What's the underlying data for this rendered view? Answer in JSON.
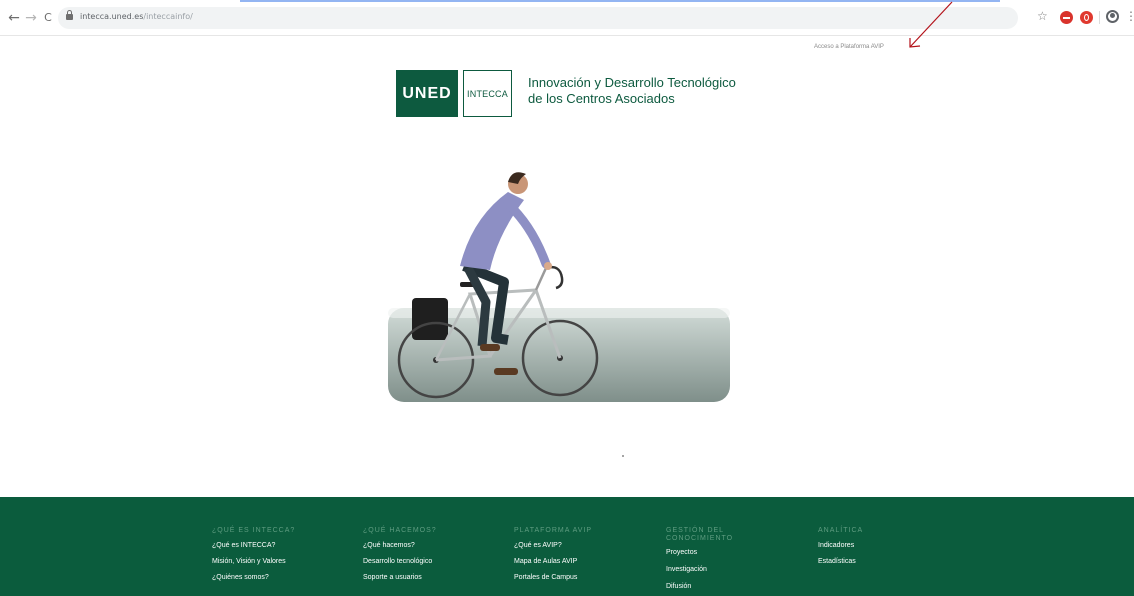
{
  "browser": {
    "url_host": "intecca.uned.es",
    "url_path": "/inteccainfo/",
    "icons": [
      "back-arrow-icon",
      "forward-arrow-icon",
      "reload-icon",
      "lock-icon",
      "star-icon",
      "extension-icon",
      "opera-icon",
      "profile-icon",
      "kebab-menu-icon"
    ],
    "glyphs": {
      "back": "←",
      "forward": "→",
      "reload": "C",
      "star": "☆",
      "menu": "⋮"
    }
  },
  "header": {
    "access_link": "Acceso a Plataforma AVIP",
    "annotation_arrow_color": "#b3121a"
  },
  "brand": {
    "uned": "UNED",
    "intecca": "INTECCA",
    "tagline_line1": "Innovación y Desarrollo Tecnológico",
    "tagline_line2": "de los Centros Asociados",
    "color": "#0d5a3f"
  },
  "footer": {
    "background": "#0b5c3d",
    "columns": [
      {
        "heading": "¿QUÉ ES INTECCA?",
        "links": [
          "¿Qué es INTECCA?",
          "Misión, Visión y Valores",
          "¿Quiénes somos?"
        ]
      },
      {
        "heading": "¿QUÉ HACEMOS?",
        "links": [
          "¿Qué hacemos?",
          "Desarrollo tecnológico",
          "Soporte a usuarios"
        ]
      },
      {
        "heading": "PLATAFORMA AVIP",
        "links": [
          "¿Qué es AVIP?",
          "Mapa de Aulas AVIP",
          "Portales de Campus"
        ]
      },
      {
        "heading_line1": "GESTIÓN DEL",
        "heading_line2": "CONOCIMIENTO",
        "links": [
          "Proyectos",
          "Investigación",
          "Difusión"
        ]
      },
      {
        "heading": "ANALÍTICA",
        "links": [
          "Indicadores",
          "Estadísticas"
        ]
      }
    ]
  }
}
